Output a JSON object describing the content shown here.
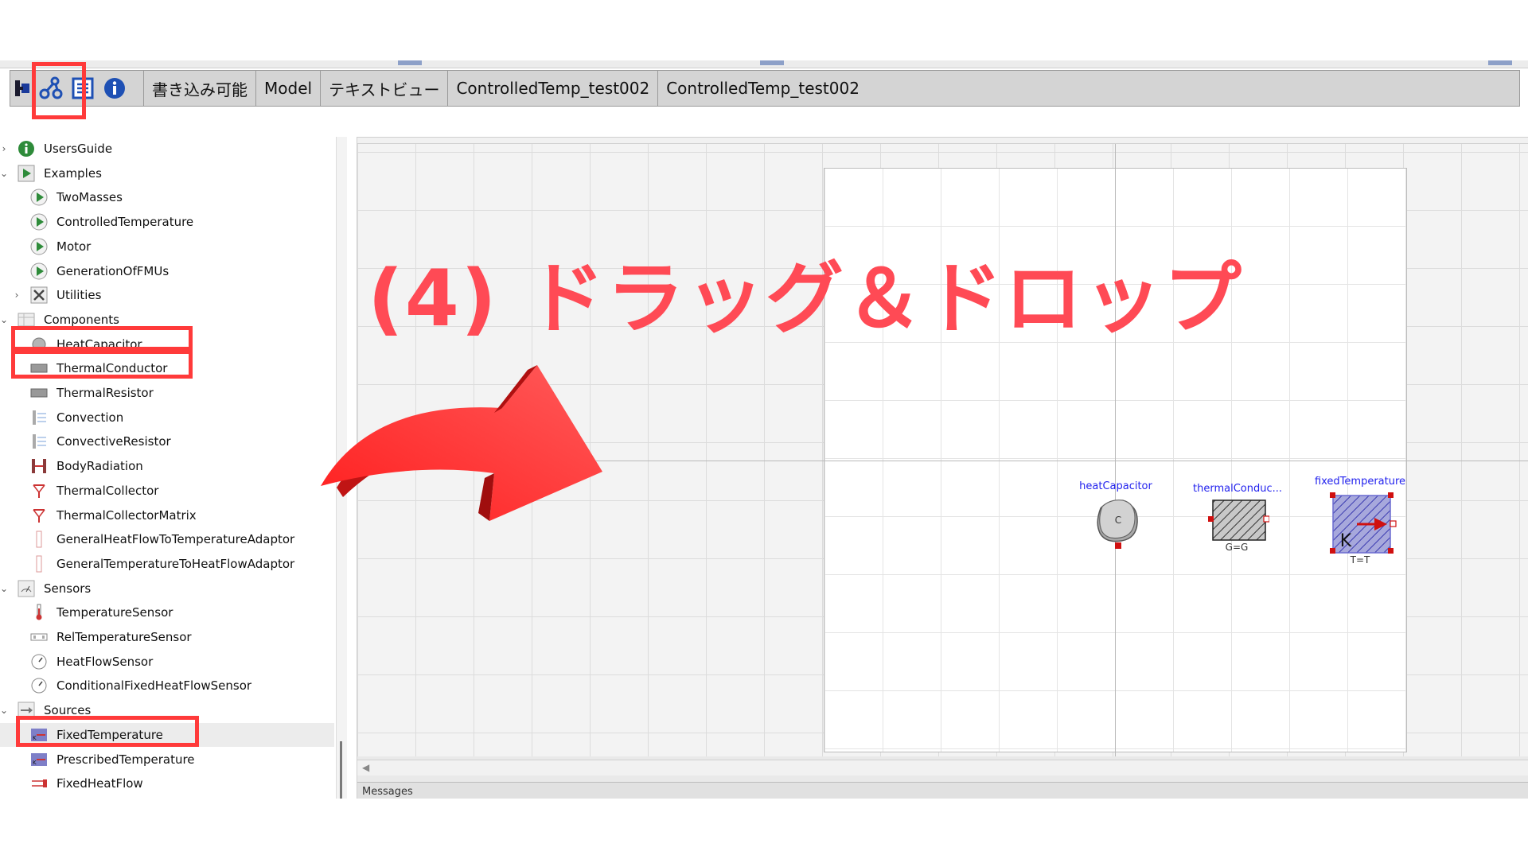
{
  "toolbar": {
    "icons": [
      "plugin-icon",
      "diagram-view-icon",
      "text-view-icon",
      "info-icon"
    ],
    "cells": [
      "書き込み可能",
      "Model",
      "テキストビュー",
      "ControlledTemp_test002",
      "ControlledTemp_test002"
    ]
  },
  "tree": {
    "items": [
      {
        "label": "UsersGuide",
        "icon": "info-circle-icon",
        "level": 0,
        "expander": "›"
      },
      {
        "label": "Examples",
        "icon": "play-icon",
        "level": 0,
        "expander": "⌄"
      },
      {
        "label": "TwoMasses",
        "icon": "play-circle-icon",
        "level": 1,
        "expander": ""
      },
      {
        "label": "ControlledTemperature",
        "icon": "play-circle-icon",
        "level": 1,
        "expander": ""
      },
      {
        "label": "Motor",
        "icon": "play-circle-icon",
        "level": 1,
        "expander": ""
      },
      {
        "label": "GenerationOfFMUs",
        "icon": "play-circle-icon",
        "level": 1,
        "expander": ""
      },
      {
        "label": "Utilities",
        "icon": "tools-icon",
        "level": 1,
        "expander": "›"
      },
      {
        "label": "Components",
        "icon": "components-package-icon",
        "level": 0,
        "expander": "⌄"
      },
      {
        "label": "HeatCapacitor",
        "icon": "heat-capacitor-icon",
        "level": 1,
        "expander": ""
      },
      {
        "label": "ThermalConductor",
        "icon": "thermal-conductor-icon",
        "level": 1,
        "expander": ""
      },
      {
        "label": "ThermalResistor",
        "icon": "thermal-resistor-icon",
        "level": 1,
        "expander": ""
      },
      {
        "label": "Convection",
        "icon": "convection-icon",
        "level": 1,
        "expander": ""
      },
      {
        "label": "ConvectiveResistor",
        "icon": "convective-resistor-icon",
        "level": 1,
        "expander": ""
      },
      {
        "label": "BodyRadiation",
        "icon": "body-radiation-icon",
        "level": 1,
        "expander": ""
      },
      {
        "label": "ThermalCollector",
        "icon": "thermal-collector-icon",
        "level": 1,
        "expander": ""
      },
      {
        "label": "ThermalCollectorMatrix",
        "icon": "thermal-collector-matrix-icon",
        "level": 1,
        "expander": ""
      },
      {
        "label": "GeneralHeatFlowToTemperatureAdaptor",
        "icon": "adaptor-icon",
        "level": 1,
        "expander": ""
      },
      {
        "label": "GeneralTemperatureToHeatFlowAdaptor",
        "icon": "adaptor-icon",
        "level": 1,
        "expander": ""
      },
      {
        "label": "Sensors",
        "icon": "sensors-package-icon",
        "level": 0,
        "expander": "⌄"
      },
      {
        "label": "TemperatureSensor",
        "icon": "thermometer-icon",
        "level": 1,
        "expander": ""
      },
      {
        "label": "RelTemperatureSensor",
        "icon": "rel-temperature-sensor-icon",
        "level": 1,
        "expander": ""
      },
      {
        "label": "HeatFlowSensor",
        "icon": "gauge-icon",
        "level": 1,
        "expander": ""
      },
      {
        "label": "ConditionalFixedHeatFlowSensor",
        "icon": "gauge-icon",
        "level": 1,
        "expander": ""
      },
      {
        "label": "Sources",
        "icon": "sources-package-icon",
        "level": 0,
        "expander": "⌄"
      },
      {
        "label": "FixedTemperature",
        "icon": "fixed-temperature-icon",
        "level": 1,
        "expander": "",
        "selected": true
      },
      {
        "label": "PrescribedTemperature",
        "icon": "prescribed-temperature-icon",
        "level": 1,
        "expander": ""
      },
      {
        "label": "FixedHeatFlow",
        "icon": "fixed-heat-flow-icon",
        "level": 1,
        "expander": ""
      }
    ]
  },
  "canvas": {
    "messages_label": "Messages",
    "components": [
      {
        "name": "heatCapacitor",
        "sub": "",
        "inner": "C"
      },
      {
        "name": "thermalConduc...",
        "sub": "G=G",
        "inner": ""
      },
      {
        "name": "fixedTemperature",
        "sub": "T=T",
        "inner": "K"
      }
    ]
  },
  "overlay": {
    "title": "(4) ドラッグ＆ドロップ",
    "arrow_color": "#ff2a2a",
    "highlight_color": "#ff3a3a"
  }
}
